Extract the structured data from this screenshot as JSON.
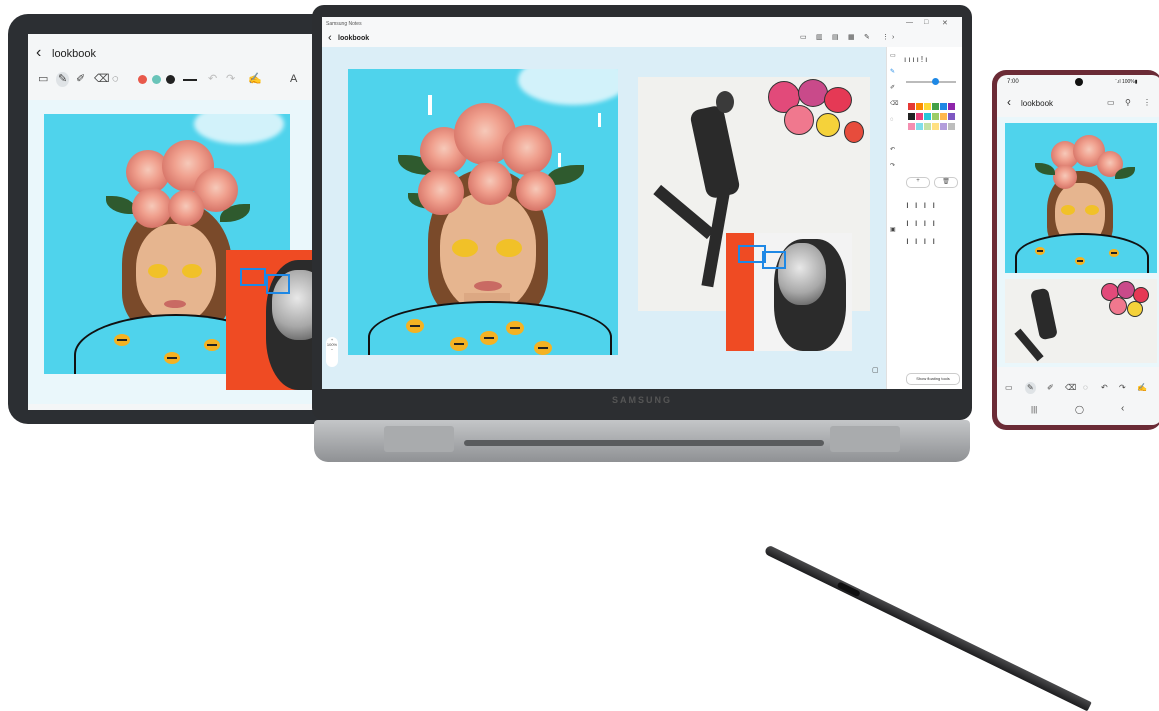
{
  "brand": "SAMSUNG",
  "app_name": "Samsung Notes",
  "tablet": {
    "note_title": "lookbook",
    "back_icon": "chevron-left-icon",
    "tool_colors": [
      "#e8594b",
      "#69c4b9",
      "#222222"
    ]
  },
  "laptop": {
    "app_name": "Samsung Notes",
    "note_title": "lookbook",
    "zoom": "100%",
    "floating_tools_label": "Show floating tools",
    "window_controls": [
      "—",
      "□",
      "✕"
    ],
    "palette": [
      "#e53935",
      "#fb8c00",
      "#fdd835",
      "#43a047",
      "#1e88e5",
      "#8e24aa",
      "#222222",
      "#ec407a",
      "#26c6da",
      "#9ccc65",
      "#ffb74d",
      "#7e57c2",
      "#f48fb1",
      "#80deea",
      "#c5e1a5",
      "#ffe082",
      "#b39ddb",
      "#bdbdbd"
    ]
  },
  "phone": {
    "time": "7:00",
    "status": "¨.ıl 100%▮",
    "note_title": "lookbook",
    "nav": [
      "|||",
      "◯",
      "‹"
    ]
  },
  "colors": {
    "sky": "#4fd3ec",
    "red_panel": "#ef4b23",
    "accent_blue": "#1e88e5",
    "phone_frame": "#6b2b36"
  }
}
